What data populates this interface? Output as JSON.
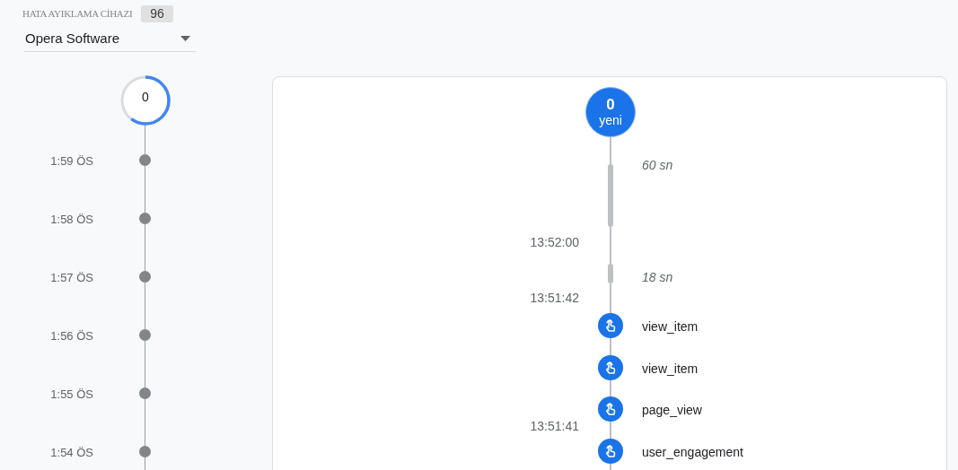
{
  "device_picker": {
    "label": "HATA AYIKLAMA CİHAZI",
    "count": "96",
    "value": "Opera Software"
  },
  "minutes": {
    "counter": "0",
    "level": 0.6,
    "items": [
      "1:59 ÖS",
      "1:58 ÖS",
      "1:57 ÖS",
      "1:56 ÖS",
      "1:55 ÖS",
      "1:54 ÖS"
    ]
  },
  "seconds": {
    "new_count": "0",
    "new_label": "yeni",
    "entries": [
      {
        "kind": "longgap",
        "label": "60 sn"
      },
      {
        "kind": "time",
        "label": "13:52:00"
      },
      {
        "kind": "shortgap",
        "label": "18 sn"
      },
      {
        "kind": "time",
        "label": "13:51:42"
      },
      {
        "kind": "event",
        "label": "view_item"
      },
      {
        "kind": "event",
        "label": "view_item"
      },
      {
        "kind": "event",
        "label": "page_view"
      },
      {
        "kind": "event",
        "label": "user_engagement",
        "time": "13:51:41"
      }
    ]
  }
}
